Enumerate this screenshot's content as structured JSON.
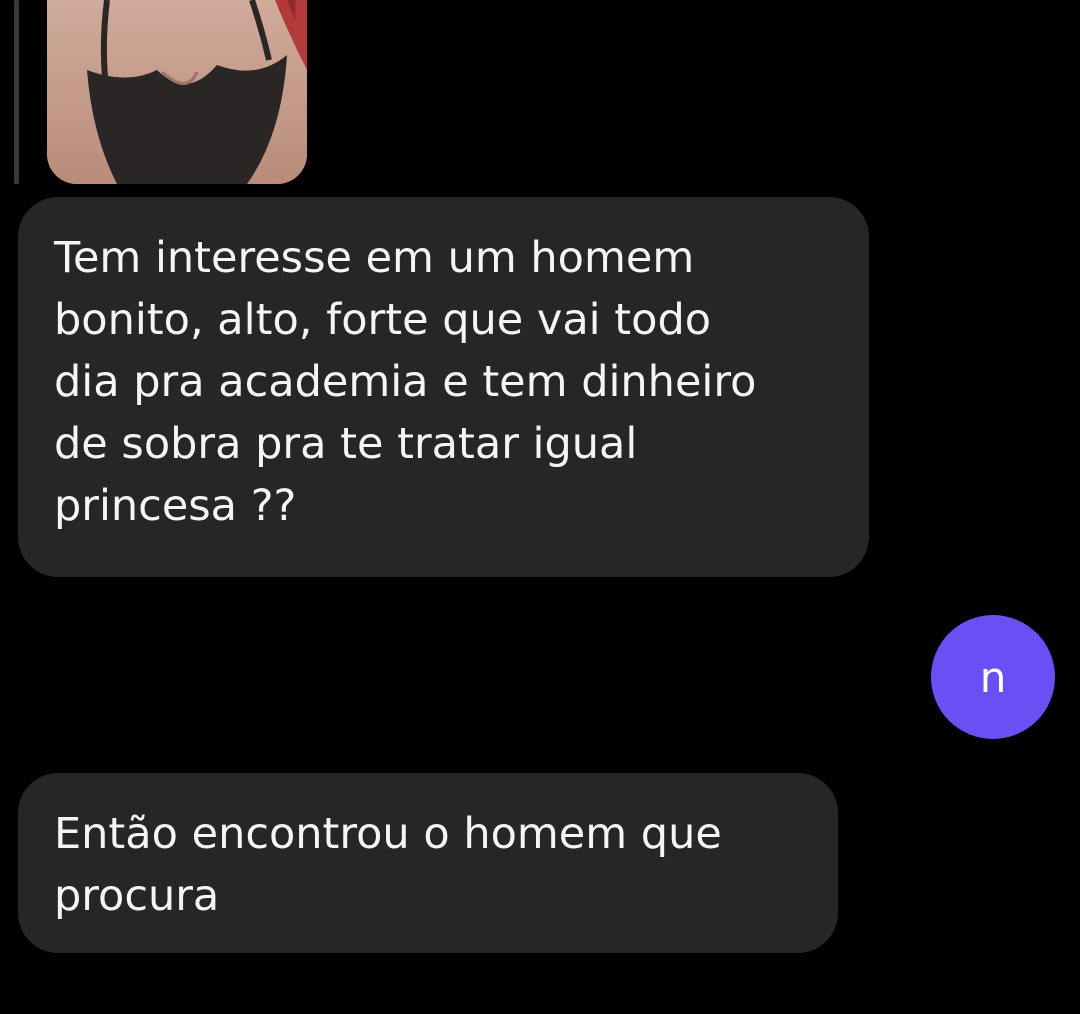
{
  "messages": {
    "received_1": "Tem interesse em um homem\nbonito, alto, forte que vai todo\ndia pra academia e tem dinheiro\nde sobra pra te tratar igual\nprincesa ??",
    "sent_1": "n",
    "received_2": "Então encontrou o homem que\nprocura"
  },
  "colors": {
    "background": "#000000",
    "received_bubble": "#262626",
    "sent_bubble": "#6a50f4",
    "text": "#f5f5f5"
  }
}
